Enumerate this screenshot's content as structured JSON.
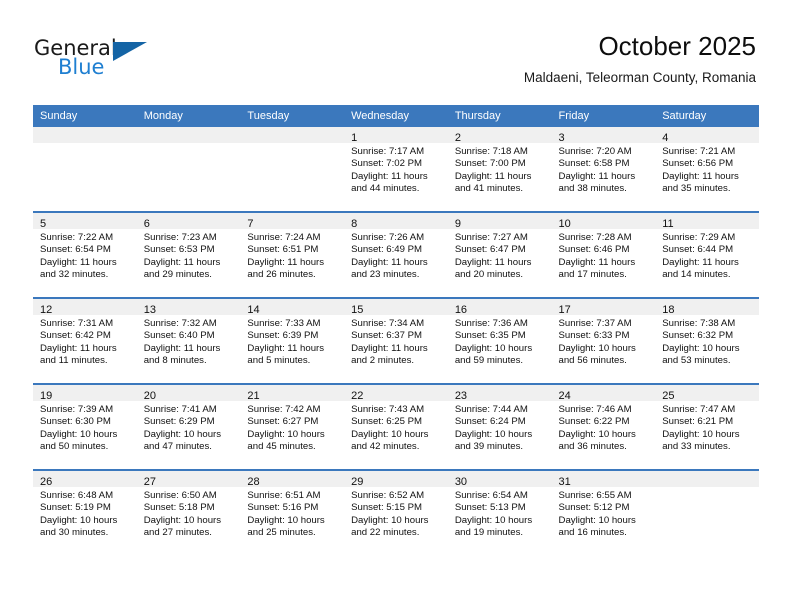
{
  "brand": {
    "name_part1": "General",
    "name_part2": "Blue",
    "flag_icon": "triangle-flag-icon",
    "accent_color": "#1464a5"
  },
  "header": {
    "title": "October 2025",
    "subtitle": "Maldaeni, Teleorman County, Romania"
  },
  "theme": {
    "header_blue": "#3b78bd",
    "daynum_band": "#f0f0f0",
    "brand_blue": "#1f7fd1"
  },
  "calendar": {
    "weekday_headers": [
      "Sunday",
      "Monday",
      "Tuesday",
      "Wednesday",
      "Thursday",
      "Friday",
      "Saturday"
    ],
    "weeks": [
      [
        {
          "day": "",
          "empty": true,
          "lines": []
        },
        {
          "day": "",
          "empty": true,
          "lines": []
        },
        {
          "day": "",
          "empty": true,
          "lines": []
        },
        {
          "day": "1",
          "empty": false,
          "lines": [
            "Sunrise: 7:17 AM",
            "Sunset: 7:02 PM",
            "Daylight: 11 hours",
            "and 44 minutes."
          ]
        },
        {
          "day": "2",
          "empty": false,
          "lines": [
            "Sunrise: 7:18 AM",
            "Sunset: 7:00 PM",
            "Daylight: 11 hours",
            "and 41 minutes."
          ]
        },
        {
          "day": "3",
          "empty": false,
          "lines": [
            "Sunrise: 7:20 AM",
            "Sunset: 6:58 PM",
            "Daylight: 11 hours",
            "and 38 minutes."
          ]
        },
        {
          "day": "4",
          "empty": false,
          "lines": [
            "Sunrise: 7:21 AM",
            "Sunset: 6:56 PM",
            "Daylight: 11 hours",
            "and 35 minutes."
          ]
        }
      ],
      [
        {
          "day": "5",
          "empty": false,
          "lines": [
            "Sunrise: 7:22 AM",
            "Sunset: 6:54 PM",
            "Daylight: 11 hours",
            "and 32 minutes."
          ]
        },
        {
          "day": "6",
          "empty": false,
          "lines": [
            "Sunrise: 7:23 AM",
            "Sunset: 6:53 PM",
            "Daylight: 11 hours",
            "and 29 minutes."
          ]
        },
        {
          "day": "7",
          "empty": false,
          "lines": [
            "Sunrise: 7:24 AM",
            "Sunset: 6:51 PM",
            "Daylight: 11 hours",
            "and 26 minutes."
          ]
        },
        {
          "day": "8",
          "empty": false,
          "lines": [
            "Sunrise: 7:26 AM",
            "Sunset: 6:49 PM",
            "Daylight: 11 hours",
            "and 23 minutes."
          ]
        },
        {
          "day": "9",
          "empty": false,
          "lines": [
            "Sunrise: 7:27 AM",
            "Sunset: 6:47 PM",
            "Daylight: 11 hours",
            "and 20 minutes."
          ]
        },
        {
          "day": "10",
          "empty": false,
          "lines": [
            "Sunrise: 7:28 AM",
            "Sunset: 6:46 PM",
            "Daylight: 11 hours",
            "and 17 minutes."
          ]
        },
        {
          "day": "11",
          "empty": false,
          "lines": [
            "Sunrise: 7:29 AM",
            "Sunset: 6:44 PM",
            "Daylight: 11 hours",
            "and 14 minutes."
          ]
        }
      ],
      [
        {
          "day": "12",
          "empty": false,
          "lines": [
            "Sunrise: 7:31 AM",
            "Sunset: 6:42 PM",
            "Daylight: 11 hours",
            "and 11 minutes."
          ]
        },
        {
          "day": "13",
          "empty": false,
          "lines": [
            "Sunrise: 7:32 AM",
            "Sunset: 6:40 PM",
            "Daylight: 11 hours",
            "and 8 minutes."
          ]
        },
        {
          "day": "14",
          "empty": false,
          "lines": [
            "Sunrise: 7:33 AM",
            "Sunset: 6:39 PM",
            "Daylight: 11 hours",
            "and 5 minutes."
          ]
        },
        {
          "day": "15",
          "empty": false,
          "lines": [
            "Sunrise: 7:34 AM",
            "Sunset: 6:37 PM",
            "Daylight: 11 hours",
            "and 2 minutes."
          ]
        },
        {
          "day": "16",
          "empty": false,
          "lines": [
            "Sunrise: 7:36 AM",
            "Sunset: 6:35 PM",
            "Daylight: 10 hours",
            "and 59 minutes."
          ]
        },
        {
          "day": "17",
          "empty": false,
          "lines": [
            "Sunrise: 7:37 AM",
            "Sunset: 6:33 PM",
            "Daylight: 10 hours",
            "and 56 minutes."
          ]
        },
        {
          "day": "18",
          "empty": false,
          "lines": [
            "Sunrise: 7:38 AM",
            "Sunset: 6:32 PM",
            "Daylight: 10 hours",
            "and 53 minutes."
          ]
        }
      ],
      [
        {
          "day": "19",
          "empty": false,
          "lines": [
            "Sunrise: 7:39 AM",
            "Sunset: 6:30 PM",
            "Daylight: 10 hours",
            "and 50 minutes."
          ]
        },
        {
          "day": "20",
          "empty": false,
          "lines": [
            "Sunrise: 7:41 AM",
            "Sunset: 6:29 PM",
            "Daylight: 10 hours",
            "and 47 minutes."
          ]
        },
        {
          "day": "21",
          "empty": false,
          "lines": [
            "Sunrise: 7:42 AM",
            "Sunset: 6:27 PM",
            "Daylight: 10 hours",
            "and 45 minutes."
          ]
        },
        {
          "day": "22",
          "empty": false,
          "lines": [
            "Sunrise: 7:43 AM",
            "Sunset: 6:25 PM",
            "Daylight: 10 hours",
            "and 42 minutes."
          ]
        },
        {
          "day": "23",
          "empty": false,
          "lines": [
            "Sunrise: 7:44 AM",
            "Sunset: 6:24 PM",
            "Daylight: 10 hours",
            "and 39 minutes."
          ]
        },
        {
          "day": "24",
          "empty": false,
          "lines": [
            "Sunrise: 7:46 AM",
            "Sunset: 6:22 PM",
            "Daylight: 10 hours",
            "and 36 minutes."
          ]
        },
        {
          "day": "25",
          "empty": false,
          "lines": [
            "Sunrise: 7:47 AM",
            "Sunset: 6:21 PM",
            "Daylight: 10 hours",
            "and 33 minutes."
          ]
        }
      ],
      [
        {
          "day": "26",
          "empty": false,
          "lines": [
            "Sunrise: 6:48 AM",
            "Sunset: 5:19 PM",
            "Daylight: 10 hours",
            "and 30 minutes."
          ]
        },
        {
          "day": "27",
          "empty": false,
          "lines": [
            "Sunrise: 6:50 AM",
            "Sunset: 5:18 PM",
            "Daylight: 10 hours",
            "and 27 minutes."
          ]
        },
        {
          "day": "28",
          "empty": false,
          "lines": [
            "Sunrise: 6:51 AM",
            "Sunset: 5:16 PM",
            "Daylight: 10 hours",
            "and 25 minutes."
          ]
        },
        {
          "day": "29",
          "empty": false,
          "lines": [
            "Sunrise: 6:52 AM",
            "Sunset: 5:15 PM",
            "Daylight: 10 hours",
            "and 22 minutes."
          ]
        },
        {
          "day": "30",
          "empty": false,
          "lines": [
            "Sunrise: 6:54 AM",
            "Sunset: 5:13 PM",
            "Daylight: 10 hours",
            "and 19 minutes."
          ]
        },
        {
          "day": "31",
          "empty": false,
          "lines": [
            "Sunrise: 6:55 AM",
            "Sunset: 5:12 PM",
            "Daylight: 10 hours",
            "and 16 minutes."
          ]
        },
        {
          "day": "",
          "empty": true,
          "lines": []
        }
      ]
    ]
  }
}
